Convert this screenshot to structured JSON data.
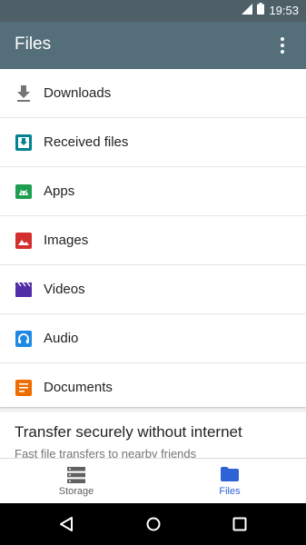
{
  "status_bar": {
    "time": "19:53",
    "icons": [
      "signal-icon",
      "battery-icon"
    ]
  },
  "app_bar": {
    "title": "Files",
    "menu_icon": "more-vert-icon"
  },
  "categories": [
    {
      "label": "Downloads",
      "icon": "download-icon",
      "color": "#757575"
    },
    {
      "label": "Received files",
      "icon": "received-files-icon",
      "color": "#00838f"
    },
    {
      "label": "Apps",
      "icon": "android-icon",
      "color": "#1e9e4f"
    },
    {
      "label": "Images",
      "icon": "image-icon",
      "color": "#d32f2f"
    },
    {
      "label": "Videos",
      "icon": "video-icon",
      "color": "#512da8"
    },
    {
      "label": "Audio",
      "icon": "headphones-icon",
      "color": "#1e88e5"
    },
    {
      "label": "Documents",
      "icon": "document-icon",
      "color": "#ef6c00"
    }
  ],
  "promo": {
    "title": "Transfer securely without internet",
    "subtitle": "Fast file transfers to nearby friends"
  },
  "bottom_nav": {
    "items": [
      {
        "label": "Storage",
        "icon": "storage-icon",
        "active": false
      },
      {
        "label": "Files",
        "icon": "folder-icon",
        "active": true
      }
    ],
    "active_color": "#2e63d6",
    "inactive_color": "#616161"
  },
  "system_nav": {
    "icons": [
      "back-icon",
      "home-icon",
      "recents-icon"
    ]
  }
}
